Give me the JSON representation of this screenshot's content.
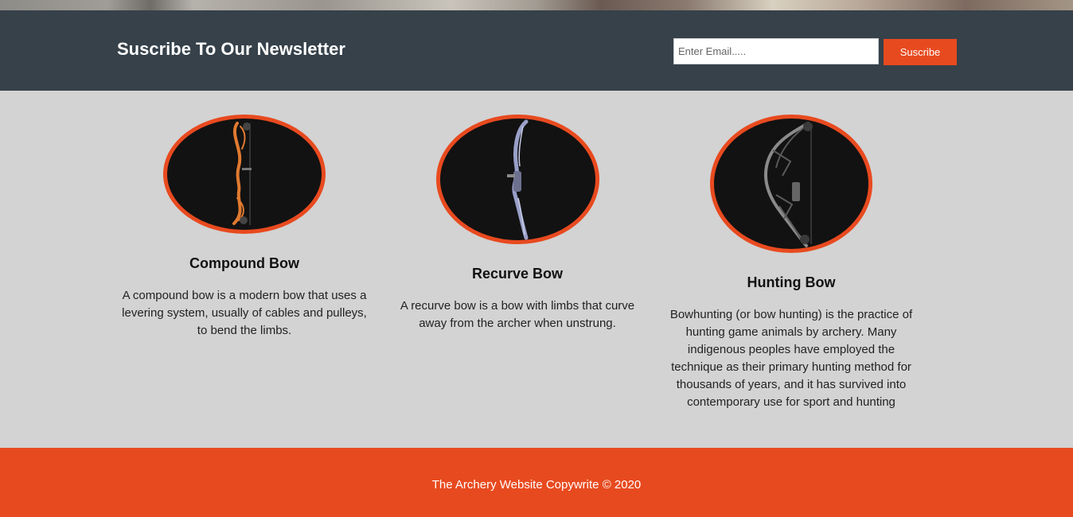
{
  "newsletter": {
    "title": "Suscribe To Our Newsletter",
    "email_placeholder": "Enter Email.....",
    "subscribe_label": "Suscribe"
  },
  "cards": [
    {
      "title": "Compound Bow",
      "text": "A compound bow is a modern bow that uses a levering system, usually of cables and pulleys, to bend the limbs.",
      "image_icon": "compound-bow-icon",
      "bow_color": "#e07a30"
    },
    {
      "title": "Recurve Bow",
      "text": "A recurve bow is a bow with limbs that curve away from the archer when unstrung.",
      "image_icon": "recurve-bow-icon",
      "bow_color": "#9aa0c8"
    },
    {
      "title": "Hunting Bow",
      "text": "Bowhunting (or bow hunting) is the practice of hunting game animals by archery. Many indigenous peoples have employed the technique as their primary hunting method for thousands of years, and it has survived into contemporary use for sport and hunting",
      "image_icon": "hunting-bow-icon",
      "bow_color": "#8a8a8a"
    }
  ],
  "footer": {
    "text": "The Archery Website Copywrite © 2020"
  },
  "colors": {
    "accent": "#e84a1f",
    "newsletter_bg": "#36414a",
    "body_bg": "#d3d3d3"
  }
}
